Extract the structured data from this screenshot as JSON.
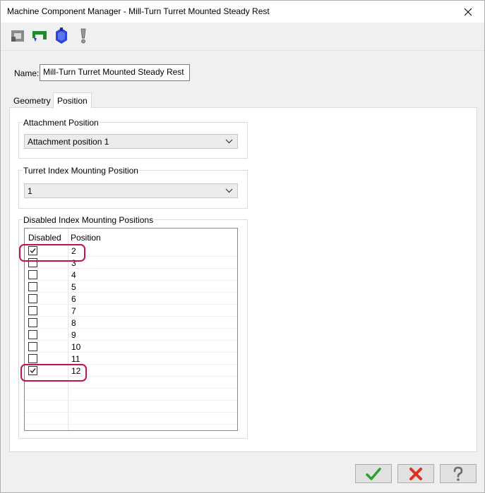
{
  "window": {
    "title": "Machine Component Manager - Mill-Turn Turret Mounted Steady Rest"
  },
  "toolbar": {
    "icons": [
      "component-icon",
      "holder-icon",
      "turret-icon",
      "warning-icon"
    ]
  },
  "name_field": {
    "label": "Name:",
    "value": "Mill-Turn Turret Mounted Steady Rest"
  },
  "tabs": [
    {
      "label": "Geometry",
      "active": false
    },
    {
      "label": "Position",
      "active": true
    }
  ],
  "attachment_position": {
    "title": "Attachment Position",
    "selected": "Attachment position 1"
  },
  "turret_index": {
    "title": "Turret Index Mounting Position",
    "selected": "1"
  },
  "disabled_positions": {
    "title": "Disabled Index Mounting Positions",
    "columns": [
      "Disabled",
      "Position"
    ],
    "rows": [
      {
        "position": "2",
        "disabled": true
      },
      {
        "position": "3",
        "disabled": false
      },
      {
        "position": "4",
        "disabled": false
      },
      {
        "position": "5",
        "disabled": false
      },
      {
        "position": "6",
        "disabled": false
      },
      {
        "position": "7",
        "disabled": false
      },
      {
        "position": "8",
        "disabled": false
      },
      {
        "position": "9",
        "disabled": false
      },
      {
        "position": "10",
        "disabled": false
      },
      {
        "position": "11",
        "disabled": false
      },
      {
        "position": "12",
        "disabled": true
      }
    ]
  },
  "buttons": {
    "ok": "ok-checkmark",
    "cancel": "cancel-x",
    "help": "help-question"
  },
  "colors": {
    "highlight": "#c4124d",
    "ok_green": "#2aa12a",
    "cancel_red": "#e0301e"
  }
}
